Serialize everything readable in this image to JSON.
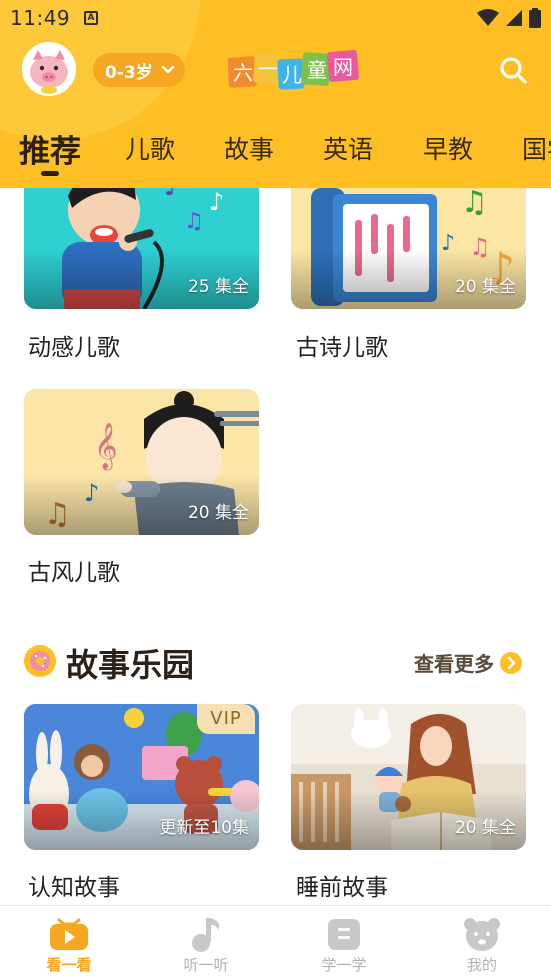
{
  "status_bar": {
    "time": "11:49",
    "notification_badge": "A"
  },
  "header": {
    "age_selector": "0-3岁",
    "logo_text": [
      "六",
      "一",
      "儿",
      "童",
      "网"
    ],
    "tabs": [
      "推荐",
      "儿歌",
      "故事",
      "英语",
      "早教",
      "国学"
    ],
    "active_tab": 0
  },
  "songs": {
    "cards": [
      {
        "title": "动感儿歌",
        "badge": "25 集全"
      },
      {
        "title": "古诗儿歌",
        "badge": "20 集全"
      },
      {
        "title": "古风儿歌",
        "badge": "20 集全"
      }
    ]
  },
  "story_section": {
    "title": "故事乐园",
    "more_label": "查看更多",
    "cards": [
      {
        "title": "认知故事",
        "badge": "更新至10集",
        "vip": "VIP"
      },
      {
        "title": "睡前故事",
        "badge": "20 集全"
      }
    ]
  },
  "bottom_nav": {
    "items": [
      {
        "label": "看一看",
        "icon": "tv-icon"
      },
      {
        "label": "听一听",
        "icon": "music-note-icon"
      },
      {
        "label": "学一学",
        "icon": "book-icon"
      },
      {
        "label": "我的",
        "icon": "bear-icon"
      }
    ],
    "active": 0
  },
  "colors": {
    "brand": "#FDBF24",
    "accent": "#F5A623"
  }
}
